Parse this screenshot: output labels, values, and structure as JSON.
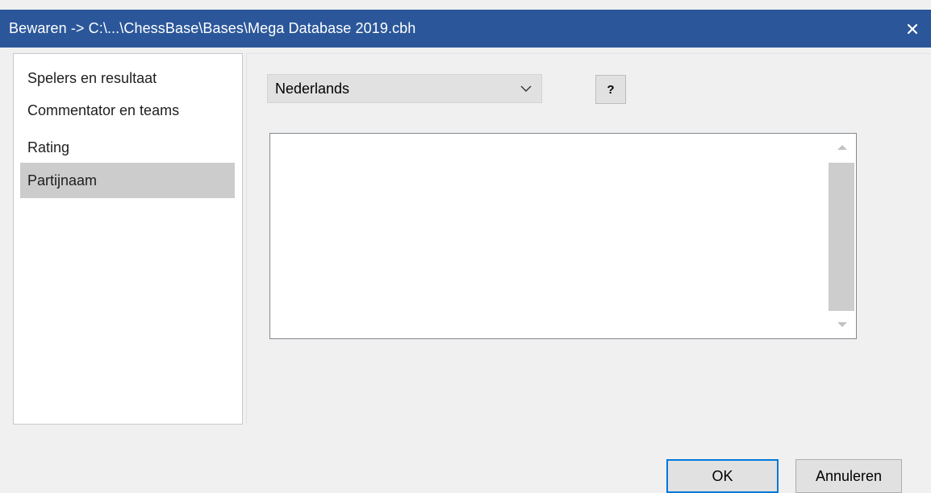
{
  "window": {
    "title": "Bewaren -> C:\\...\\ChessBase\\Bases\\Mega Database 2019.cbh",
    "close_icon": "close-icon"
  },
  "sidebar": {
    "items": [
      {
        "label": "Spelers en resultaat",
        "selected": false
      },
      {
        "label": "Commentator en teams",
        "selected": false
      },
      {
        "label": "Rating",
        "selected": false
      },
      {
        "label": "Partijnaam",
        "selected": true
      }
    ]
  },
  "content": {
    "language_select": {
      "value": "Nederlands",
      "icon": "chevron-down-icon"
    },
    "help_button": {
      "label": "?"
    },
    "listbox": {
      "items": [],
      "scroll_up_icon": "triangle-up-icon",
      "scroll_down_icon": "triangle-down-icon"
    }
  },
  "footer": {
    "ok_label": "OK",
    "cancel_label": "Annuleren"
  },
  "colors": {
    "titlebar": "#2b579a",
    "selection": "#cccccc",
    "focus_border": "#0078d7",
    "dialog_bg": "#f0f0f0"
  }
}
